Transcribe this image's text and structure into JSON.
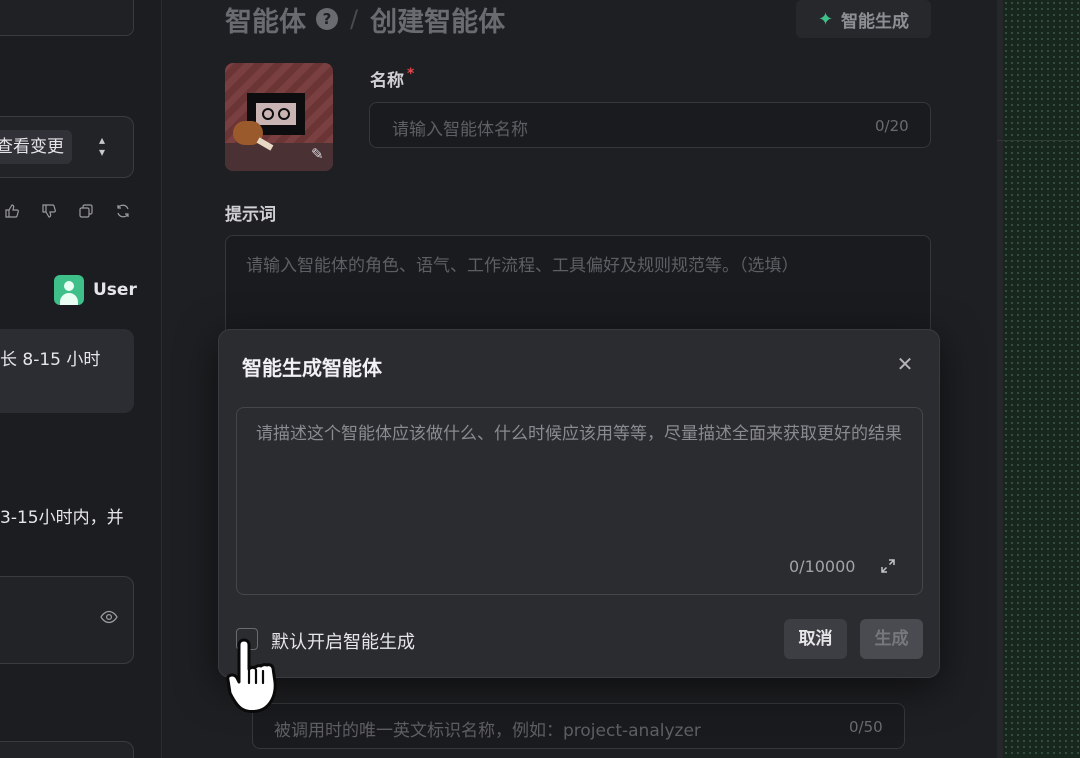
{
  "left_panel": {
    "change_button_label": "查看变更",
    "updown_icon": "chevron-up-down-icon",
    "action_icons": [
      "thumbs-up-icon",
      "thumbs-down-icon",
      "copy-icon",
      "refresh-icon"
    ],
    "user_label": "User",
    "bubble_text": "长 8-15 小时",
    "message_text": "3-15小时内，并",
    "eye_icon": "eye-icon"
  },
  "header": {
    "breadcrumb_root": "智能体",
    "breadcrumb_separator": "/",
    "breadcrumb_current": "创建智能体",
    "help_icon_glyph": "?",
    "generate_button_label": "智能生成"
  },
  "form": {
    "name_label": "名称",
    "required_mark": "*",
    "name_placeholder": "请输入智能体名称",
    "name_counter": "0/20",
    "prompt_label": "提示词",
    "prompt_placeholder": "请输入智能体的角色、语气、工作流程、工具偏好及规则规范等。（选填）",
    "identifier_placeholder": "被调用时的唯一英文标识名称，例如：project-analyzer",
    "identifier_counter": "0/50"
  },
  "modal": {
    "title": "智能生成智能体",
    "close_glyph": "✕",
    "textarea_placeholder": "请描述这个智能体应该做什么、什么时候应该用等等，尽量描述全面来获取更好的结果",
    "counter": "0/10000",
    "checkbox_label": "默认开启智能生成",
    "checkbox_checked": false,
    "cancel_label": "取消",
    "generate_label": "生成",
    "generate_disabled": true
  },
  "colors": {
    "accent_green": "#3fbf8a",
    "required_red": "#e5484d",
    "modal_bg": "#2b2c30"
  }
}
